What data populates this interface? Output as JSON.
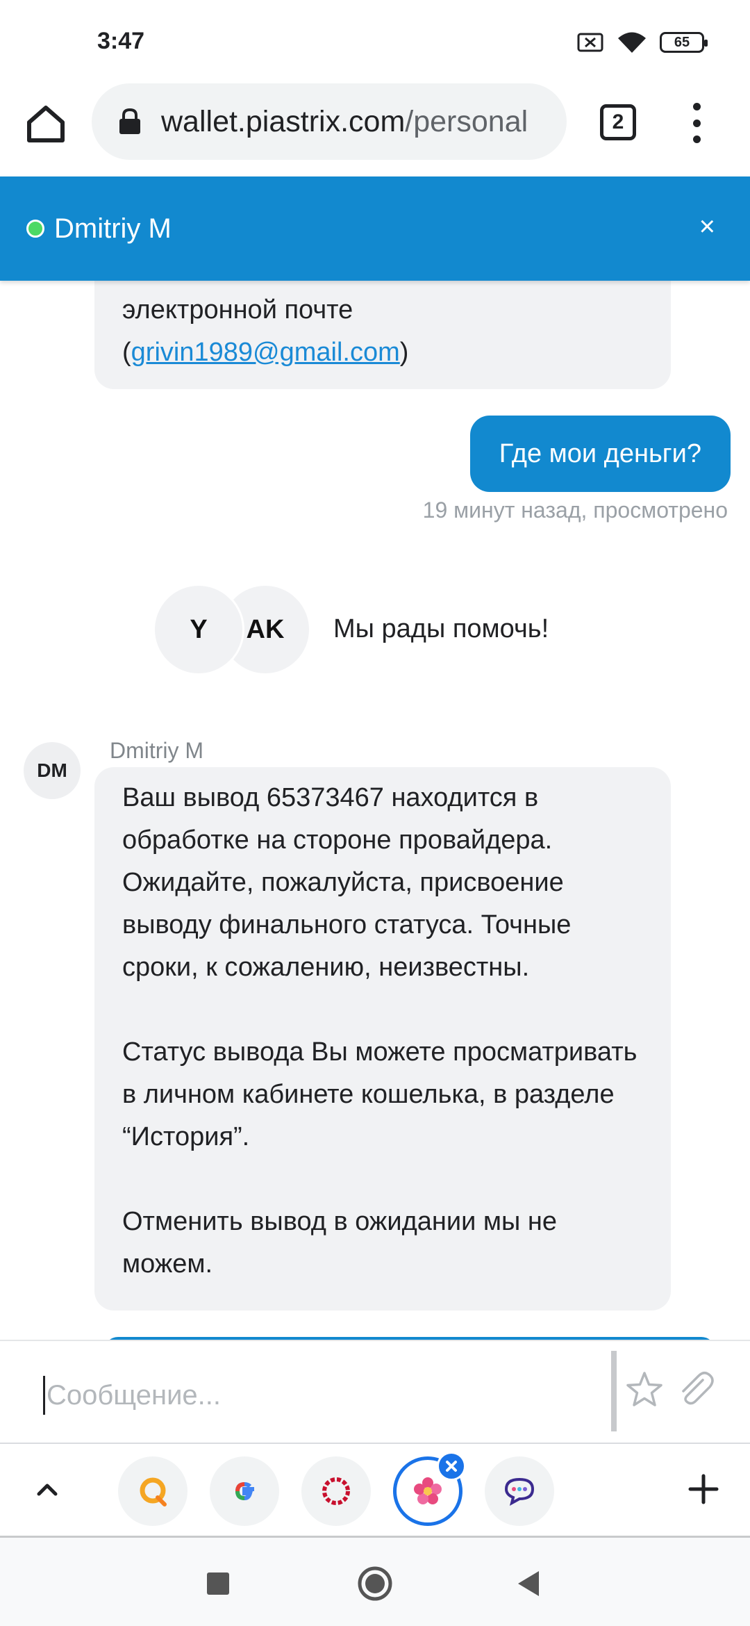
{
  "status_bar": {
    "time": "3:47",
    "battery": "65",
    "icons": [
      "sim-off-icon",
      "wifi-icon",
      "battery-icon"
    ]
  },
  "browser": {
    "url_host": "wallet.piastrix.com",
    "url_path": "/personal",
    "tab_count": "2",
    "icons": [
      "home-icon",
      "lock-icon",
      "tabs-icon",
      "more-vert-icon"
    ]
  },
  "chat": {
    "header": {
      "agent_name": "Dmitriy M",
      "close_label": "×",
      "online_color": "#4cd964",
      "accent": "#1289cf"
    },
    "messages": {
      "top_fragment_line": "электронной почте",
      "email_open": "(",
      "email": "grivin1989@gmail.com",
      "email_close": ")",
      "outgoing_text": "Где мои деньги?",
      "outgoing_meta": "19 минут назад, просмотрено",
      "avatar_y": "Y",
      "avatar_ak": "AK",
      "greeting": "Мы рады помочь!",
      "agent_initials": "DM",
      "agent_name": "Dmitriy M",
      "paragraph_1": "Ваш вывод 65373467 находится в обработке на стороне провайдера. Ожидайте, пожалуйста, присвоение выводу финального статуса. Точные сроки, к сожалению, неизвестны.",
      "paragraph_2": "Статус вывода Вы можете просматривать в личном кабинете кошелька, в разделе “История”.",
      "paragraph_3": "Отменить вывод в ожидании мы не можем."
    },
    "composer": {
      "placeholder": "Сообщение...",
      "value": "",
      "icons": [
        "star-icon",
        "paperclip-icon"
      ]
    }
  },
  "app_bar": {
    "apps": [
      "qiwi-app-icon",
      "google-app-icon",
      "opera-app-icon",
      "flower-app-icon",
      "chat-app-icon"
    ],
    "icons": [
      "chevron-up-icon",
      "plus-icon"
    ]
  },
  "nav_bar": {
    "icons": [
      "recents-icon",
      "home-circle-icon",
      "back-icon"
    ]
  }
}
